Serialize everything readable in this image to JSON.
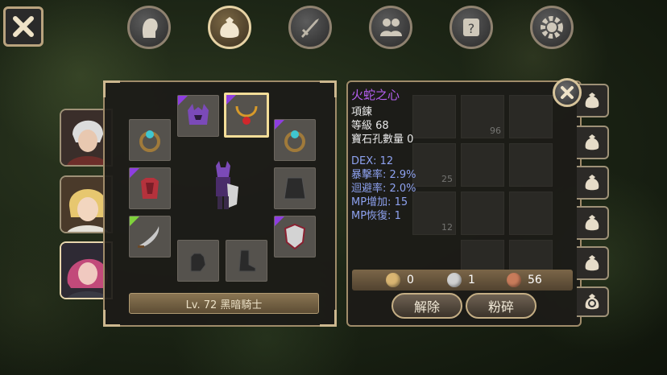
{
  "nav": {
    "close_icon": "close-icon",
    "tabs": [
      {
        "icon": "character-head-icon",
        "active": false
      },
      {
        "icon": "bag-icon",
        "active": true
      },
      {
        "icon": "sword-icon",
        "active": false
      },
      {
        "icon": "party-icon",
        "active": false
      },
      {
        "icon": "quest-scroll-icon",
        "active": false
      },
      {
        "icon": "gear-icon",
        "active": false
      }
    ]
  },
  "characters": [
    {
      "name": "white-haired-knight",
      "selected": false
    },
    {
      "name": "blonde-girl",
      "selected": false
    },
    {
      "name": "pink-haired-knight",
      "selected": true
    }
  ],
  "equipment": {
    "level_label": "Lv. 72 黑暗騎士",
    "slots": [
      {
        "id": "helmet",
        "rarity": "purple"
      },
      {
        "id": "necklace",
        "rarity": "purple",
        "selected": true
      },
      {
        "id": "ring-left",
        "rarity": "purple"
      },
      {
        "id": "ring-right",
        "rarity": "purple"
      },
      {
        "id": "armor",
        "rarity": "purple"
      },
      {
        "id": "cape",
        "rarity": "none"
      },
      {
        "id": "weapon",
        "rarity": "green"
      },
      {
        "id": "shield",
        "rarity": "purple"
      },
      {
        "id": "gloves",
        "rarity": "none"
      },
      {
        "id": "boots",
        "rarity": "none"
      }
    ]
  },
  "tooltip": {
    "name": "火蛇之心",
    "type": "項鍊",
    "level": "等級 68",
    "gem_slots": "寶石孔數量 0",
    "stats": [
      "DEX: 12",
      "暴擊率: 2.9%",
      "迴避率: 2.0%",
      "MP增加: 15",
      "MP恢復: 1"
    ]
  },
  "inventory": {
    "counts": [
      "96",
      "25",
      "12"
    ]
  },
  "currency": {
    "gold": "0",
    "silver": "1",
    "copper": "56"
  },
  "actions": {
    "unequip": "解除",
    "smash": "粉碎"
  },
  "colors": {
    "item_name": "#b55ff0",
    "stat_text": "#8ea2f0",
    "rarity_purple": "#8e3ee0",
    "rarity_green": "#7fd23c",
    "frame_gold": "#a08c6a"
  }
}
